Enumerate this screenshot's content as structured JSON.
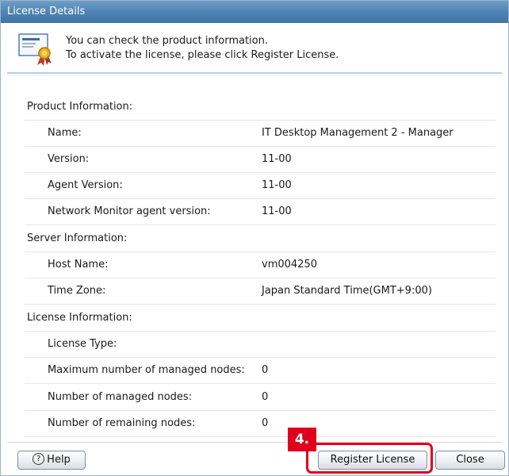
{
  "window": {
    "title": "License Details"
  },
  "header": {
    "line1": "You can check the product information.",
    "line2": "To activate the license, please click Register License.",
    "icon": "certificate-icon"
  },
  "sections": [
    {
      "label": "Product Information:",
      "items": [
        {
          "label": "Name:",
          "value": "IT Desktop Management 2 - Manager"
        },
        {
          "label": "Version:",
          "value": "11-00"
        },
        {
          "label": "Agent Version:",
          "value": "11-00"
        },
        {
          "label": "Network Monitor agent version:",
          "value": "11-00"
        }
      ]
    },
    {
      "label": "Server Information:",
      "items": [
        {
          "label": "Host Name:",
          "value": "vm004250"
        },
        {
          "label": "Time Zone:",
          "value": "Japan Standard Time(GMT+9:00)"
        }
      ]
    },
    {
      "label": "License Information:",
      "items": [
        {
          "label": "License Type:",
          "value": ""
        },
        {
          "label": "Maximum number of managed nodes:",
          "value": "0"
        },
        {
          "label": "Number of managed nodes:",
          "value": "0"
        },
        {
          "label": "Number of remaining nodes:",
          "value": "0"
        }
      ]
    }
  ],
  "buttons": {
    "help": "Help",
    "register": "Register License",
    "close": "Close"
  },
  "callout": {
    "step": "4."
  },
  "colors": {
    "titlebar": "#4f84b4",
    "callout": "#e0001b"
  }
}
